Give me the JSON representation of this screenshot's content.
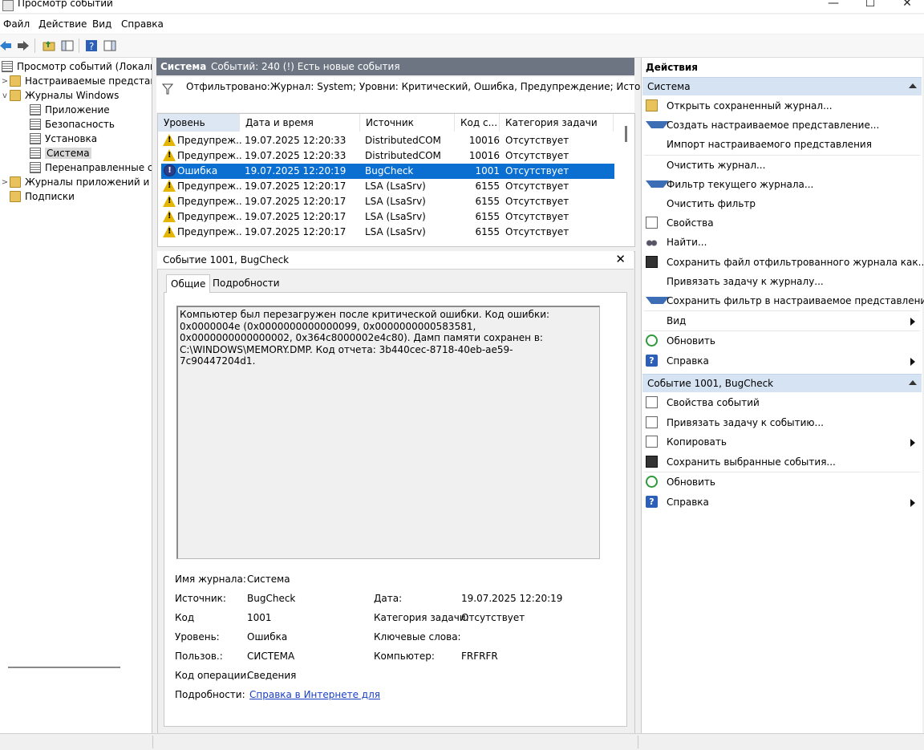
{
  "window": {
    "title": "Просмотр событий",
    "controls": [
      "—",
      "☐",
      "✕"
    ]
  },
  "menu": [
    "Файл",
    "Действие",
    "Вид",
    "Справка"
  ],
  "tree": {
    "root": "Просмотр событий (Локальный)",
    "custom_views": "Настраиваемые представления",
    "windows_logs": "Журналы Windows",
    "logs": [
      "Приложение",
      "Безопасность",
      "Установка",
      "Система",
      "Перенаправленные события"
    ],
    "app_logs": "Журналы приложений и служб",
    "subscriptions": "Подписки"
  },
  "center": {
    "header_title": "Система",
    "header_info": "Событий: 240 (!) Есть новые события",
    "filter_text": "Отфильтровано:Журнал: System; Уровни: Критический, Ошибка, Предупреждение; Источник: ."
  },
  "table": {
    "columns": [
      "Уровень",
      "Дата и время",
      "Источник",
      "Код с...",
      "Категория задачи"
    ],
    "rows": [
      {
        "level": "Предупреж...",
        "type": "warn",
        "date": "19.07.2025 12:20:33",
        "source": "DistributedCOM",
        "code": "10016",
        "category": "Отсутствует"
      },
      {
        "level": "Предупреж...",
        "type": "warn",
        "date": "19.07.2025 12:20:33",
        "source": "DistributedCOM",
        "code": "10016",
        "category": "Отсутствует"
      },
      {
        "level": "Ошибка",
        "type": "error",
        "date": "19.07.2025 12:20:19",
        "source": "BugCheck",
        "code": "1001",
        "category": "Отсутствует"
      },
      {
        "level": "Предупреж...",
        "type": "warn",
        "date": "19.07.2025 12:20:17",
        "source": "LSA (LsaSrv)",
        "code": "6155",
        "category": "Отсутствует"
      },
      {
        "level": "Предупреж...",
        "type": "warn",
        "date": "19.07.2025 12:20:17",
        "source": "LSA (LsaSrv)",
        "code": "6155",
        "category": "Отсутствует"
      },
      {
        "level": "Предупреж...",
        "type": "warn",
        "date": "19.07.2025 12:20:17",
        "source": "LSA (LsaSrv)",
        "code": "6155",
        "category": "Отсутствует"
      },
      {
        "level": "Предупреж...",
        "type": "warn",
        "date": "19.07.2025 12:20:17",
        "source": "LSA (LsaSrv)",
        "code": "6155",
        "category": "Отсутствует"
      }
    ]
  },
  "detail": {
    "title": "Событие 1001, BugCheck",
    "tabs": [
      "Общие",
      "Подробности"
    ],
    "description": "Компьютер был перезагружен после критической ошибки.  Код ошибки: 0x0000004e (0x0000000000000099, 0x0000000000583581, 0x0000000000000002, 0x364c8000002e4c80). Дамп памяти сохранен в: C:\\WINDOWS\\MEMORY.DMP. Код отчета: 3b440cec-8718-40eb-ae59-7c90447204d1.",
    "props": {
      "log_name_label": "Имя журнала:",
      "log_name": "Система",
      "source_label": "Источник:",
      "source": "BugCheck",
      "date_label": "Дата:",
      "date": "19.07.2025 12:20:19",
      "code_label": "Код",
      "code": "1001",
      "category_label": "Категория задачи:",
      "category": "Отсутствует",
      "level_label": "Уровень:",
      "level": "Ошибка",
      "keywords_label": "Ключевые слова:",
      "user_label": "Пользов.:",
      "user": "СИСТЕМА",
      "computer_label": "Компьютер:",
      "computer": "FRFRFR",
      "opcode_label": "Код операции:",
      "opcode": "Сведения",
      "details_label": "Подробности:",
      "details_link": "Справка в Интернете для"
    }
  },
  "actions": {
    "title": "Действия",
    "section1": "Система",
    "items1": [
      {
        "label": "Открыть сохраненный журнал...",
        "icon": "folder-icon"
      },
      {
        "label": "Создать настраиваемое представление...",
        "icon": "filter-icon"
      },
      {
        "label": "Импорт настраиваемого представления",
        "icon": ""
      },
      {
        "label": "Очистить журнал...",
        "icon": ""
      },
      {
        "label": "Фильтр текущего журнала...",
        "icon": "filter-icon"
      },
      {
        "label": "Очистить фильтр",
        "icon": ""
      },
      {
        "label": "Свойства",
        "icon": "properties-icon"
      },
      {
        "label": "Найти...",
        "icon": "binoculars-icon"
      },
      {
        "label": "Сохранить файл отфильтрованного журнала как...",
        "icon": "save-icon"
      },
      {
        "label": "Привязать задачу к журналу...",
        "icon": ""
      },
      {
        "label": "Сохранить фильтр в настраиваемое представление...",
        "icon": "filter-icon"
      },
      {
        "label": "Вид",
        "icon": "",
        "submenu": true
      },
      {
        "label": "Обновить",
        "icon": "refresh-icon"
      },
      {
        "label": "Справка",
        "icon": "help-icon",
        "submenu": true
      }
    ],
    "section2": "Событие 1001, BugCheck",
    "items2": [
      {
        "label": "Свойства событий",
        "icon": "properties-icon"
      },
      {
        "label": "Привязать задачу к событию...",
        "icon": "task-icon"
      },
      {
        "label": "Копировать",
        "icon": "copy-icon",
        "submenu": true
      },
      {
        "label": "Сохранить выбранные события...",
        "icon": "save-icon"
      },
      {
        "label": "Обновить",
        "icon": "refresh-icon"
      },
      {
        "label": "Справка",
        "icon": "help-icon",
        "submenu": true
      }
    ]
  }
}
